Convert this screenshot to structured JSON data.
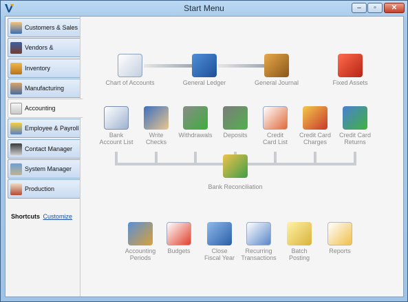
{
  "window": {
    "title": "Start Menu"
  },
  "sidebar": {
    "items": [
      {
        "label": "Customers & Sales"
      },
      {
        "label": "Vendors & Purchasing"
      },
      {
        "label": "Inventory"
      },
      {
        "label": "Manufacturing"
      },
      {
        "label": "Accounting"
      },
      {
        "label": "Employee & Payroll"
      },
      {
        "label": "Contact Manager"
      },
      {
        "label": "System Manager"
      },
      {
        "label": "Production"
      }
    ],
    "active": "Accounting"
  },
  "shortcuts": {
    "label": "Shortcuts",
    "customize": "Customize"
  },
  "main": {
    "row1": [
      {
        "label": "Chart of Accounts"
      },
      {
        "label": "General Ledger"
      },
      {
        "label": "General Journal"
      },
      {
        "label": "Fixed Assets"
      }
    ],
    "row2": [
      {
        "label": "Bank\nAccount List"
      },
      {
        "label": "Write\nChecks"
      },
      {
        "label": "Withdrawals"
      },
      {
        "label": "Deposits"
      },
      {
        "label": "Credit\nCard List"
      },
      {
        "label": "Credit Card\nCharges"
      },
      {
        "label": "Credit Card\nReturns"
      }
    ],
    "bank_reconciliation": {
      "label": "Bank Reconciliation"
    },
    "row3": [
      {
        "label": "Accounting\nPeriods"
      },
      {
        "label": "Budgets"
      },
      {
        "label": "Close\nFiscal Year"
      },
      {
        "label": "Recurring\nTransactions"
      },
      {
        "label": "Batch\nPosting"
      },
      {
        "label": "Reports"
      }
    ]
  }
}
